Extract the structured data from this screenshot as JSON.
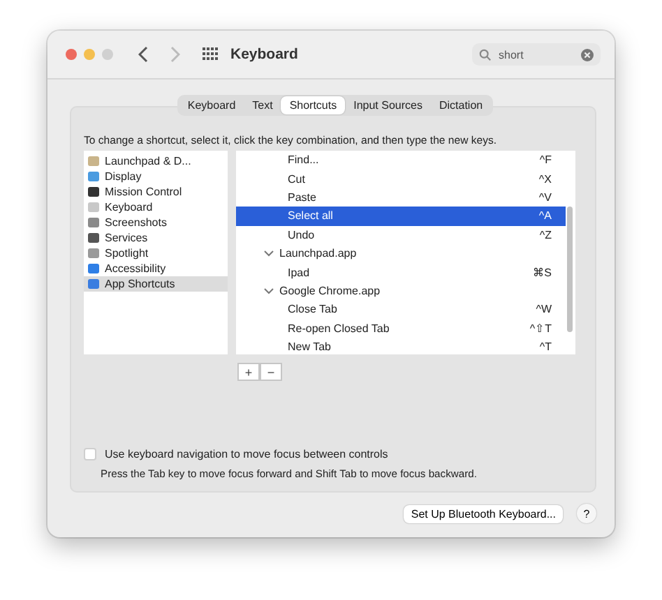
{
  "window": {
    "title": "Keyboard"
  },
  "search": {
    "value": "short"
  },
  "tabs": [
    {
      "label": "Keyboard",
      "selected": false
    },
    {
      "label": "Text",
      "selected": false
    },
    {
      "label": "Shortcuts",
      "selected": true
    },
    {
      "label": "Input Sources",
      "selected": false
    },
    {
      "label": "Dictation",
      "selected": false
    }
  ],
  "instruction": "To change a shortcut, select it, click the key combination, and then type the new keys.",
  "categories": [
    {
      "label": "Launchpad & D...",
      "color": "#c9b48a",
      "selected": false
    },
    {
      "label": "Display",
      "color": "#4a9be0",
      "selected": false
    },
    {
      "label": "Mission Control",
      "color": "#333333",
      "selected": false
    },
    {
      "label": "Keyboard",
      "color": "#c8c8c8",
      "selected": false
    },
    {
      "label": "Screenshots",
      "color": "#8a8a8a",
      "selected": false
    },
    {
      "label": "Services",
      "color": "#555555",
      "selected": false
    },
    {
      "label": "Spotlight",
      "color": "#9a9a9a",
      "selected": false
    },
    {
      "label": "Accessibility",
      "color": "#2f7fe6",
      "selected": false
    },
    {
      "label": "App Shortcuts",
      "color": "#3a7de0",
      "selected": true
    }
  ],
  "shortcut_groups": [
    {
      "children": [
        {
          "label": "Find...",
          "keys": "^F",
          "selected": false
        },
        {
          "label": "Cut",
          "keys": "^X",
          "selected": false
        },
        {
          "label": "Paste",
          "keys": "^V",
          "selected": false
        },
        {
          "label": "Select all",
          "keys": "^A",
          "selected": true
        },
        {
          "label": "Undo",
          "keys": "^Z",
          "selected": false
        }
      ]
    },
    {
      "label": "Launchpad.app",
      "expanded": true,
      "children": [
        {
          "label": "Ipad",
          "keys": "⌘S",
          "selected": false
        }
      ]
    },
    {
      "label": "Google Chrome.app",
      "expanded": true,
      "children": [
        {
          "label": "Close Tab",
          "keys": "^W",
          "selected": false
        },
        {
          "label": "Re-open Closed Tab",
          "keys": "^⇧T",
          "selected": false
        },
        {
          "label": "New Tab",
          "keys": "^T",
          "selected": false
        }
      ]
    }
  ],
  "list_buttons": [
    "+",
    "−"
  ],
  "keyboard_navigation": {
    "label": "Use keyboard navigation to move focus between controls",
    "checked": false,
    "hint": "Press the Tab key to move focus forward and Shift Tab to move focus backward."
  },
  "bluetooth_button": "Set Up Bluetooth Keyboard...",
  "help_button": "?"
}
